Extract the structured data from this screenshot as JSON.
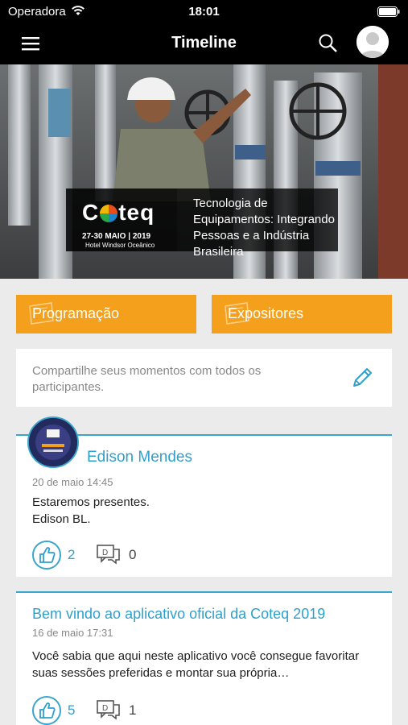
{
  "status_bar": {
    "carrier": "Operadora",
    "time": "18:01"
  },
  "nav": {
    "title": "Timeline",
    "icons": [
      "menu-icon",
      "search-icon",
      "user-avatar-icon"
    ]
  },
  "banner": {
    "brand": "Coteq",
    "dates": "27-30 MAIO | 2019",
    "venue": "Hotel Windsor Oceânico",
    "slogan": "Tecnologia de Equipamentos: Integrando Pessoas e a Indústria Brasileira"
  },
  "actions": {
    "programacao_label": "Programação",
    "expositores_label": "Expositores"
  },
  "share": {
    "placeholder": "Compartilhe seus momentos com todos os participantes."
  },
  "posts": [
    {
      "author": "Edison Mendes",
      "date": "20 de maio 14:45",
      "body_line1": "Estaremos presentes.",
      "body_line2": "Edison BL.",
      "likes": "2",
      "comments": "0"
    },
    {
      "title": "Bem vindo ao aplicativo oficial da Coteq 2019",
      "date": "16 de maio 17:31",
      "body": "Você sabia que aqui neste aplicativo você consegue favoritar suas sessões preferidas e montar sua própria…",
      "likes": "5",
      "comments": "1"
    }
  ],
  "colors": {
    "accent": "#3aa6cc",
    "orange": "#f5a01c",
    "header": "#000000",
    "background": "#ebebeb"
  }
}
